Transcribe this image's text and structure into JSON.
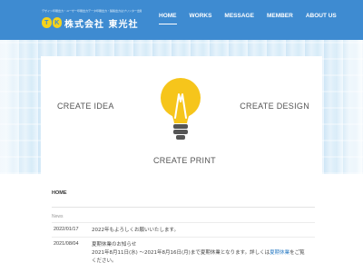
{
  "header": {
    "tagline": "デザイン印刷出力・ユーザー印刷出力データ印刷出力・製版出力はプリンター出版",
    "logo_letters": [
      "T",
      "K"
    ],
    "company_name": "株式会社 東光社",
    "nav": [
      "HOME",
      "WORKS",
      "MESSAGE",
      "MEMBER",
      "ABOUT US"
    ]
  },
  "hero": {
    "label_idea": "CREATE IDEA",
    "label_design": "CREATE DESIGN",
    "label_print": "CREATE PRINT",
    "bulb_color": "#f6c51b",
    "icon": "lightbulb-icon"
  },
  "breadcrumb": "HOME",
  "news": {
    "section_label": "News",
    "items": [
      {
        "date": "2022/01/17",
        "line1": "2022年もよろしくお願いいたします。"
      },
      {
        "date": "2021/08/04",
        "line1": "夏期休業のお知らせ",
        "line2_pre": "2021年8月11日(水) ～2021年8月16日(月)まで夏期休業となります。詳しくは",
        "line2_link": "夏期休業",
        "line2_post": "をご覧",
        "line3": "ください。"
      }
    ]
  },
  "colors": {
    "header_bg": "#3e8bd1",
    "logo_yellow": "#f4d21c",
    "link": "#2a7bc4"
  }
}
